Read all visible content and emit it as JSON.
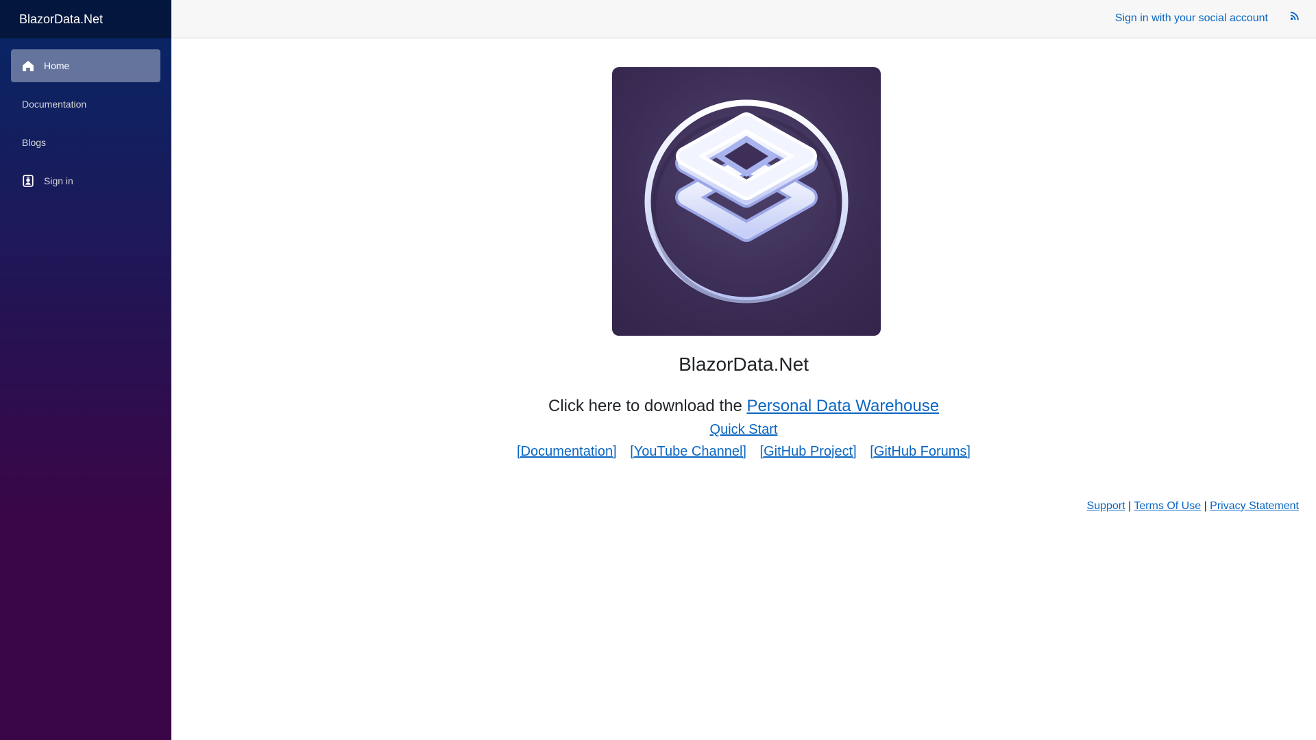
{
  "brand": "BlazorData.Net",
  "nav": [
    {
      "label": "Home",
      "icon": "home-icon",
      "active": true
    },
    {
      "label": "Documentation",
      "icon": "",
      "active": false
    },
    {
      "label": "Blogs",
      "icon": "",
      "active": false
    },
    {
      "label": "Sign in",
      "icon": "person-badge-icon",
      "active": false
    }
  ],
  "topbar": {
    "social_link": "Sign in with your social account",
    "rss_icon": "rss-icon"
  },
  "main": {
    "site_title": "BlazorData.Net",
    "download_prefix": "Click here to download the ",
    "download_link": "Personal Data Warehouse",
    "quick_start": "Quick Start",
    "links": [
      "[Documentation]",
      "[YouTube Channel]",
      "[GitHub Project]",
      "[GitHub Forums]"
    ]
  },
  "footer": {
    "support": "Support",
    "sep1": " | ",
    "terms": "Terms Of Use",
    "sep2": " | ",
    "privacy": "Privacy Statement"
  },
  "colors": {
    "link": "#0a66c2",
    "sidebar_top": "#052767",
    "sidebar_bottom": "#3a0647"
  }
}
